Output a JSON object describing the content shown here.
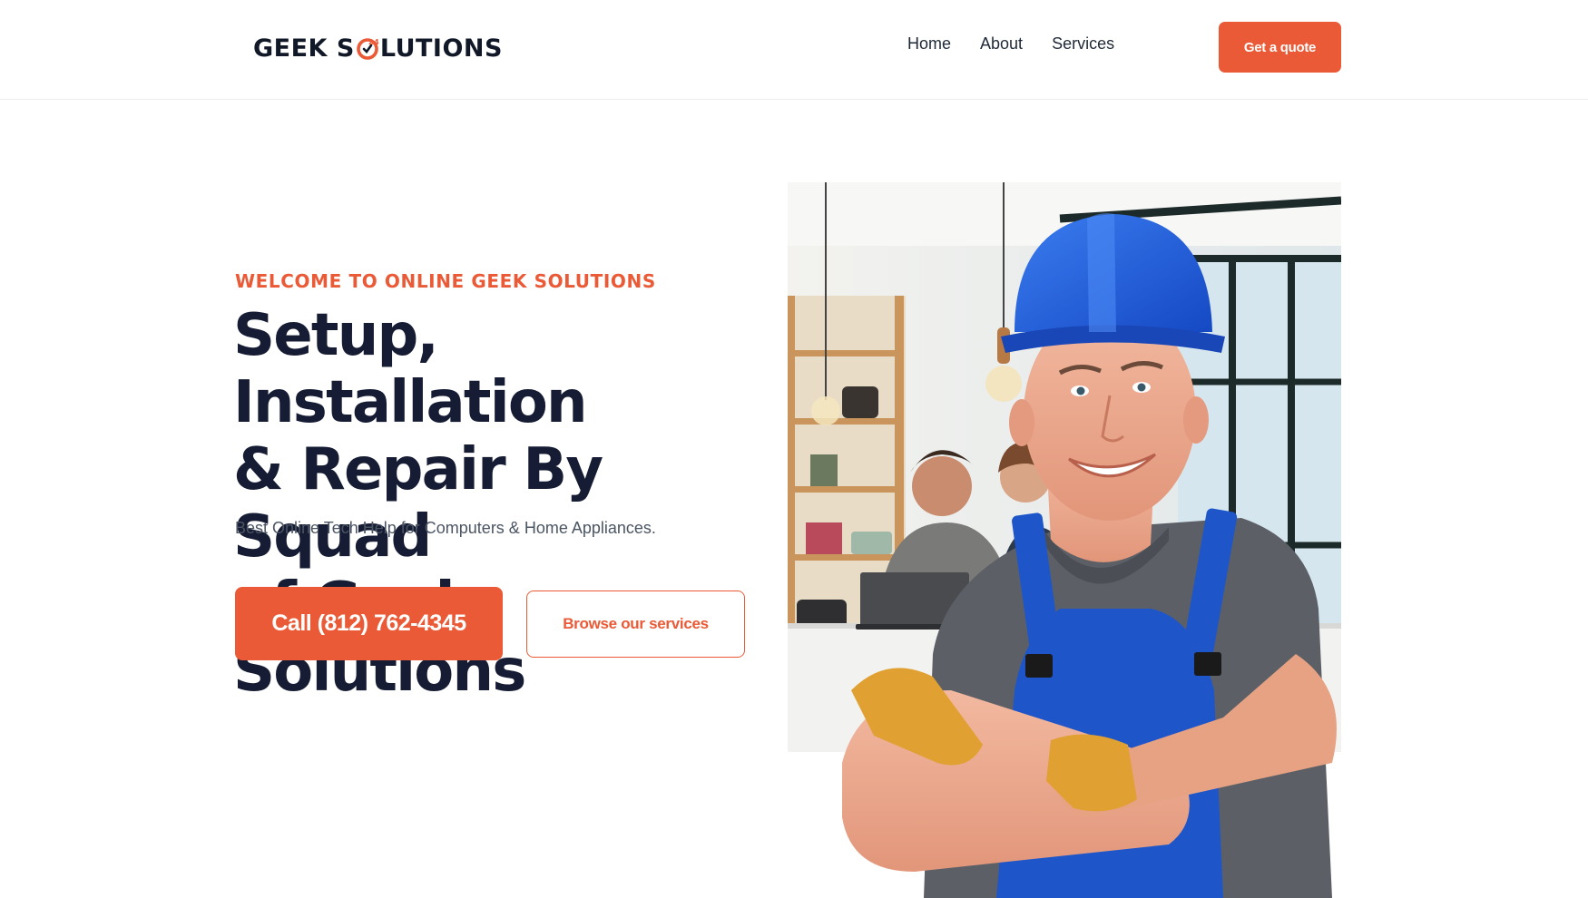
{
  "header": {
    "logo_text_left": "GEEK S",
    "logo_badge": "24",
    "logo_text_right": "LUTIONS",
    "nav": [
      {
        "label": "Home"
      },
      {
        "label": "About"
      },
      {
        "label": "Services"
      }
    ],
    "cta_label": "Get a quote"
  },
  "hero": {
    "eyebrow": "WELCOME TO ONLINE GEEK SOLUTIONS",
    "headline_lines": [
      "Setup, Installation",
      "& Repair By Squad",
      "of Geek Solutions"
    ],
    "subtitle": "Best Online Tech Help for Computers & Home Appliances.",
    "primary_button": "Call (812) 762-4345",
    "secondary_button": "Browse our services"
  },
  "colors": {
    "accent": "#ea5a36",
    "heading": "#151c33",
    "body_text": "#4b5563",
    "hard_hat": "#1f5fd6",
    "overalls": "#1e56c9"
  },
  "icons": [
    "logo-clock-icon"
  ]
}
